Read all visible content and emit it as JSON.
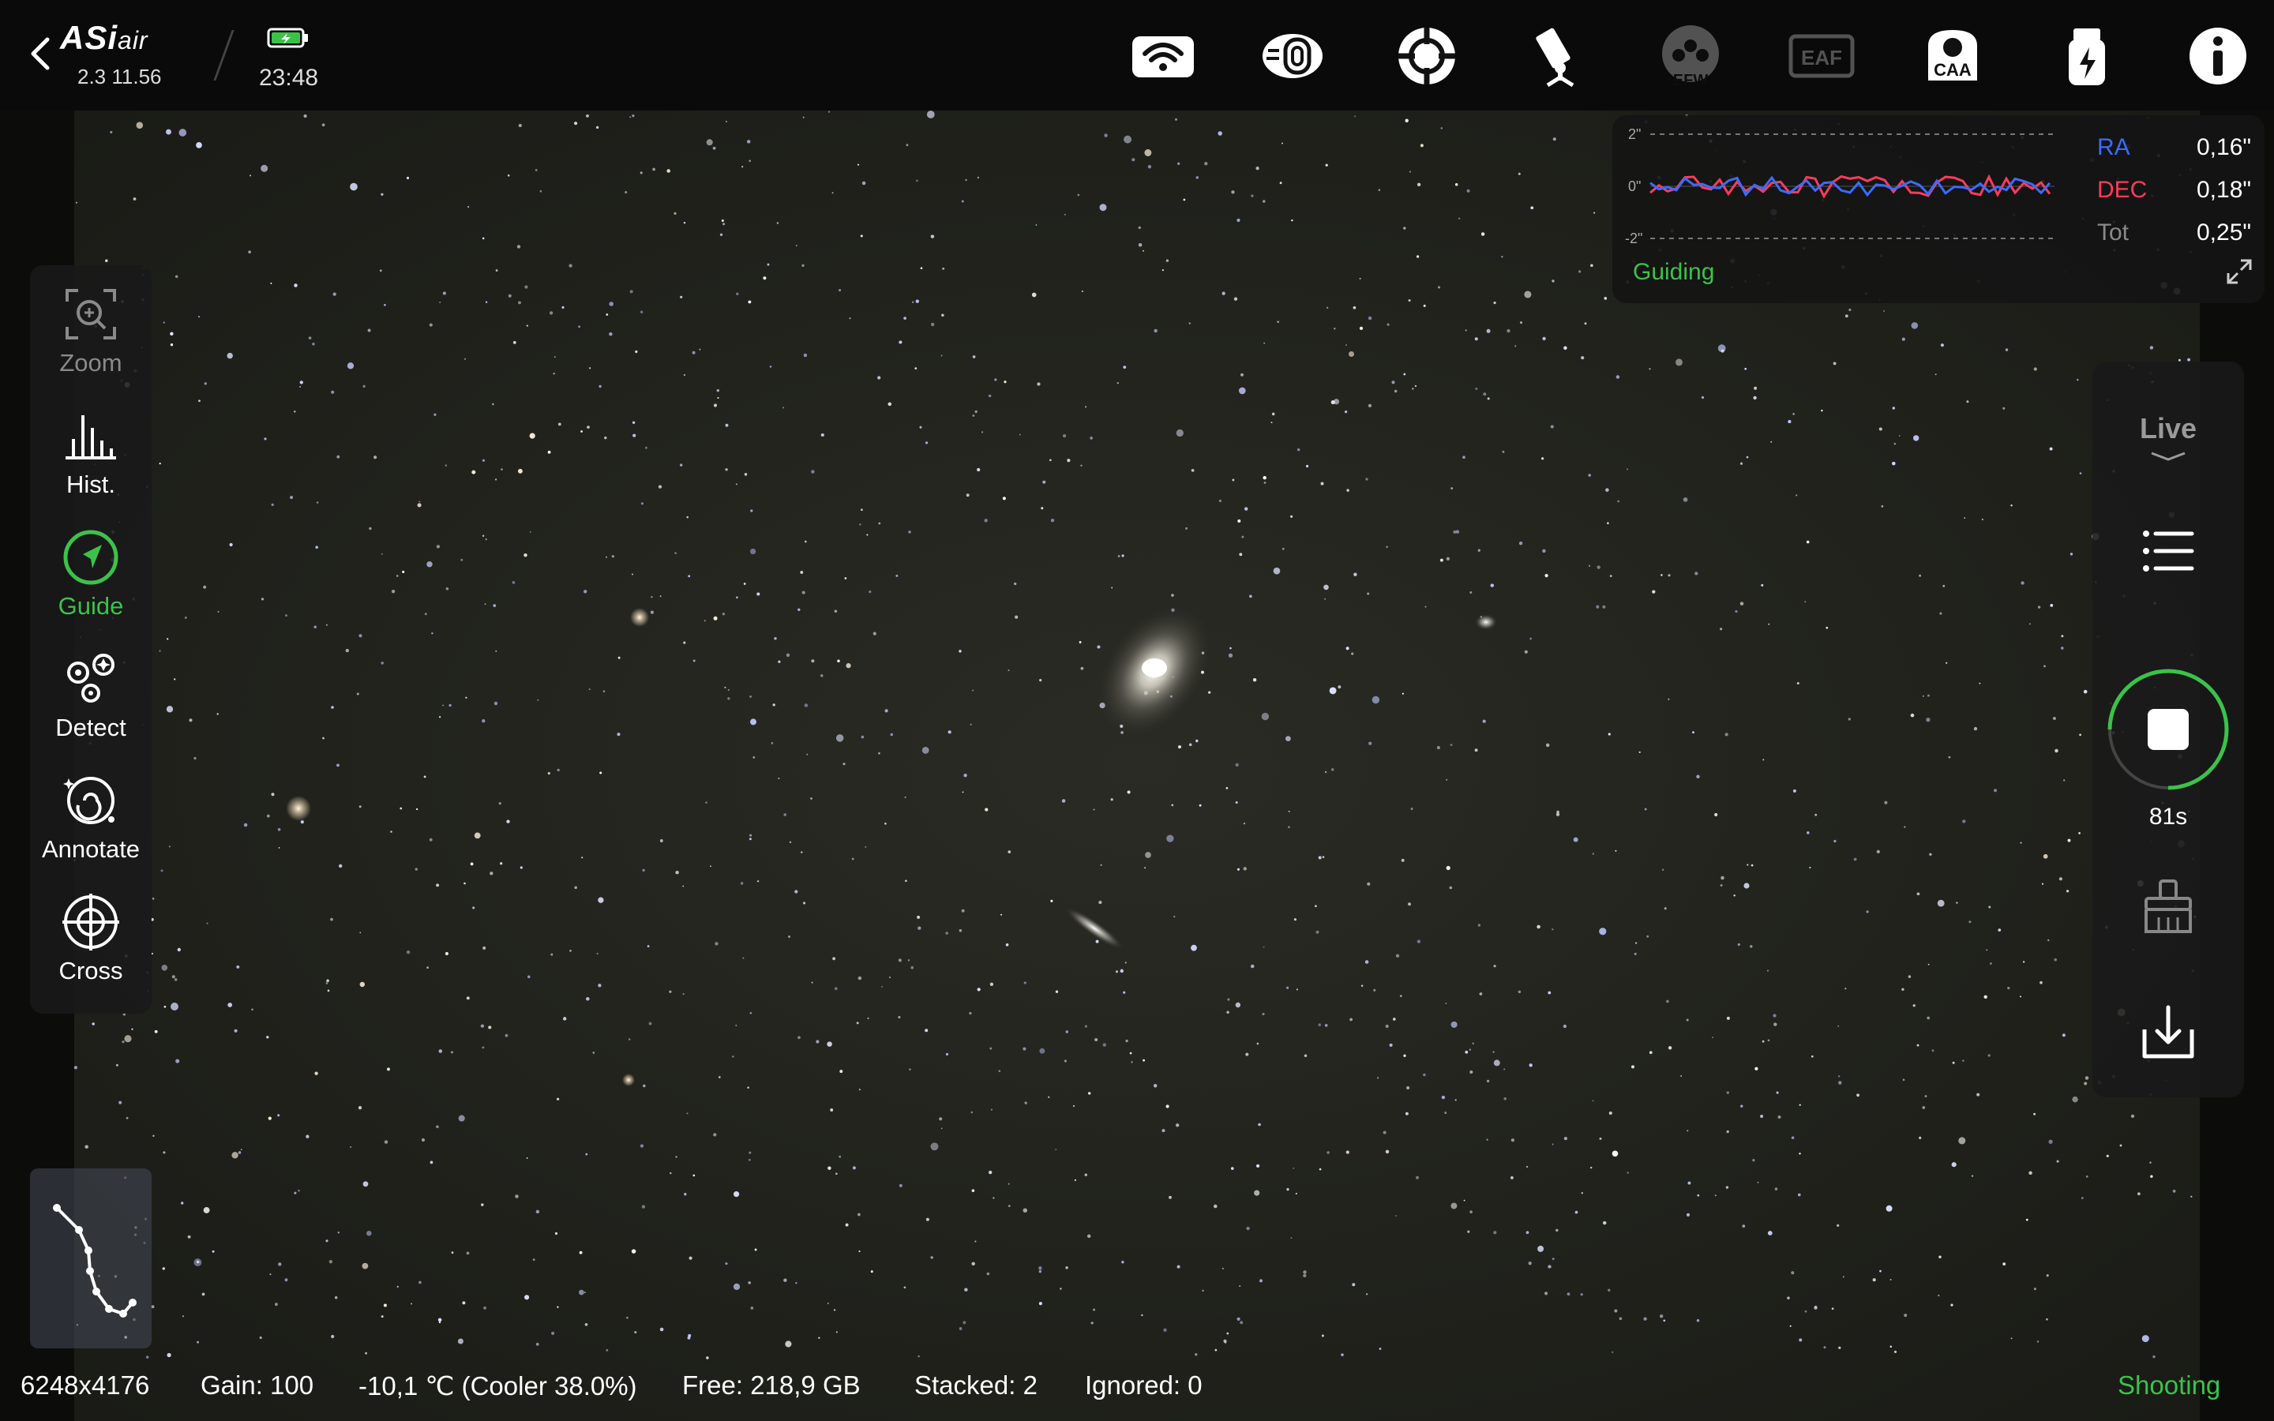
{
  "app": {
    "logo_main": "ASi",
    "logo_small": "air",
    "version": "2.3 11.56",
    "time": "23:48"
  },
  "topbar_icons": [
    {
      "name": "wifi-icon"
    },
    {
      "name": "camera-icon"
    },
    {
      "name": "mount-target-icon"
    },
    {
      "name": "telescope-icon"
    },
    {
      "name": "efw-icon",
      "label": "EFW"
    },
    {
      "name": "eaf-icon",
      "label": "EAF"
    },
    {
      "name": "caa-icon",
      "label": "CAA"
    },
    {
      "name": "usb-storage-icon"
    },
    {
      "name": "info-icon"
    }
  ],
  "guiding": {
    "axis_top": "2\"",
    "axis_mid": "0\"",
    "axis_bottom": "-2\"",
    "ra_label": "RA",
    "ra_value": "0,16\"",
    "dec_label": "DEC",
    "dec_value": "0,18\"",
    "tot_label": "Tot",
    "tot_value": "0,25\"",
    "status": "Guiding",
    "colors": {
      "ra": "#3a6cff",
      "dec": "#ff3b5c",
      "tot": "#8a8a8a",
      "status": "#3cc24a"
    }
  },
  "left_tools": [
    {
      "name": "zoom",
      "label": "Zoom",
      "state": "disabled"
    },
    {
      "name": "hist",
      "label": "Hist.",
      "state": "normal"
    },
    {
      "name": "guide",
      "label": "Guide",
      "state": "active"
    },
    {
      "name": "detect",
      "label": "Detect",
      "state": "normal"
    },
    {
      "name": "annotate",
      "label": "Annotate",
      "state": "normal"
    },
    {
      "name": "cross",
      "label": "Cross",
      "state": "normal"
    }
  ],
  "right_panel": {
    "mode": "Live",
    "countdown": "81s"
  },
  "status": {
    "resolution": "6248x4176",
    "gain": "Gain: 100",
    "temperature": "-10,1 ℃ (Cooler 38.0%)",
    "free": "Free: 218,9 GB",
    "stacked": "Stacked: 2",
    "ignored": "Ignored: 0",
    "state": "Shooting"
  },
  "accent_color": "#3cc24a"
}
